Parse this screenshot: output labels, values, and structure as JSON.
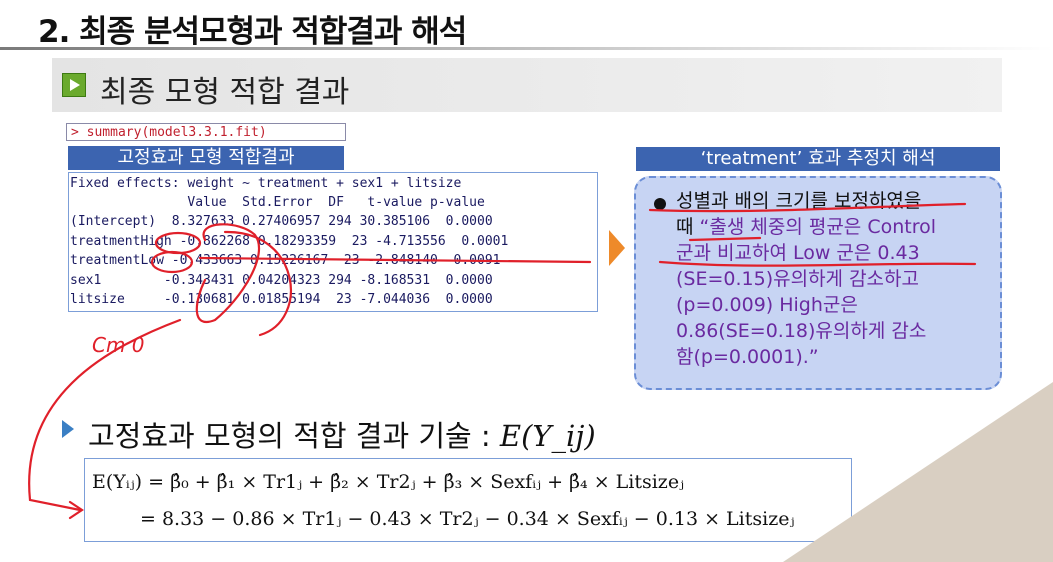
{
  "slide_title": "2. 최종 분석모형과 적합결과 해석",
  "section1": {
    "title": "최종 모형 적합 결과",
    "icon": "play-icon"
  },
  "r_command": "> summary(model3.3.1.fit)",
  "fixed_label": "고정효과 모형 적합결과",
  "r_output": {
    "header": "Fixed effects: weight ~ treatment + sex1 + litsize",
    "columns": "               Value  Std.Error  DF   t-value p-value",
    "rows": [
      "(Intercept)  8.327633 0.27406957 294 30.385106  0.0000",
      "treatmentHigh -0.862268 0.18293359  23 -4.713556  0.0001",
      "treatmentLow -0.433663 0.15226167  23 -2.848140  0.0091",
      "sex1        -0.343431 0.04204323 294 -8.168531  0.0000",
      "litsize     -0.130681 0.01855194  23 -7.044036  0.0000"
    ]
  },
  "handwriting": "Cm 0",
  "interp": {
    "label": "‘treatment’ 효과 추정치 해석",
    "lines": [
      "성별과 배의 크기를 보정하였을",
      "때 “출생 체중의 평균은 Control",
      "군과 비교하여 Low 군은 0.43",
      "(SE=0.15)유의하게 감소하고",
      "(p=0.009) High군은",
      "0.86(SE=0.18)유의하게 감소",
      "함(p=0.0001).”"
    ],
    "line1_prefix": "때",
    "line1_rest": " “출생 체중의 평균은 Control"
  },
  "section2": {
    "text": "고정효과 모형의 적합 결과 기술 : ",
    "expr": "E(Y_ij)"
  },
  "formula": {
    "line1": "E(Yᵢⱼ) = β̂₀ + β̂₁ × Tr1ⱼ + β̂₂ × Tr2ⱼ + β̂₃ × Sexfᵢⱼ + β̂₄ × Litsizeⱼ",
    "line2": "= 8.33 − 0.86 × Tr1ⱼ − 0.43 × Tr2ⱼ − 0.34 × Sexfᵢⱼ − 0.13 × Litsizeⱼ"
  },
  "colors": {
    "accent_blue": "#3c64b0",
    "code_red": "#c0202e",
    "ink_red": "#e0202a",
    "purple": "#6a2aa0"
  }
}
